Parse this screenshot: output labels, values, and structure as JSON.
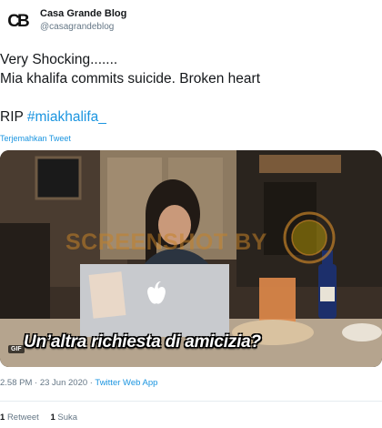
{
  "account": {
    "display_name": "Casa Grande Blog",
    "handle": "@casagrandeblog",
    "avatar_icon": "casagrande-logo-icon",
    "avatar_text": "CB"
  },
  "tweet": {
    "line1": "Very Shocking.......",
    "line2": "Mia khalifa commits suicide. Broken heart",
    "line3_prefix": "RIP ",
    "hashtag": "#miakhalifa_",
    "translate_label": "Terjemahkan Tweet"
  },
  "media": {
    "gif_badge": "GIF",
    "caption": "Un’altra richiesta di amicizia?",
    "watermark": "SCREENSHOT BY",
    "seal_text": "TURN BACK HOAX"
  },
  "meta": {
    "time": "2.58 PM",
    "separator": " · ",
    "date": "23 Jun 2020",
    "source": "Twitter Web App"
  },
  "stats": {
    "retweets_count": "1",
    "retweets_label": "Retweet",
    "likes_count": "1",
    "likes_label": "Suka"
  },
  "colors": {
    "text": "#14171a",
    "secondary": "#657786",
    "link": "#1b95e0"
  }
}
